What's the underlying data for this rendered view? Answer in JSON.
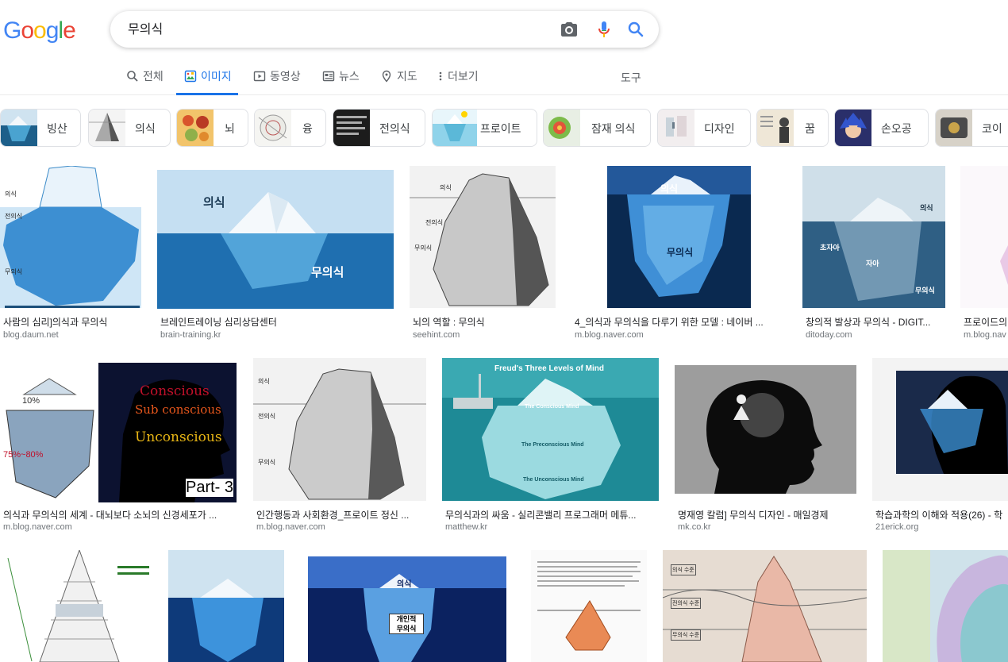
{
  "header": {
    "logo": [
      "G",
      "o",
      "o",
      "g",
      "l",
      "e"
    ],
    "logo_colors": [
      "#4285f4",
      "#ea4335",
      "#fbbc05",
      "#4285f4",
      "#34a853",
      "#ea4335"
    ],
    "query": "무의식"
  },
  "tabs": {
    "all": "전체",
    "images": "이미지",
    "videos": "동영상",
    "news": "뉴스",
    "maps": "지도",
    "more": "더보기",
    "tools": "도구"
  },
  "chips": [
    "빙산",
    "의식",
    "뇌",
    "융",
    "전의식",
    "프로이트",
    "잠재 의식",
    "디자인",
    "꿈",
    "손오공",
    "코이"
  ],
  "results": [
    {
      "title": "사람의 심리]의식과 무의식",
      "source": "blog.daum.net",
      "labels": [
        "의식",
        "전의식",
        "무의식"
      ]
    },
    {
      "title": "브레인트레이닝 심리상담센터",
      "source": "brain-training.kr",
      "labels": [
        "의식",
        "무의식"
      ]
    },
    {
      "title": "뇌의 역할 : 무의식",
      "source": "seehint.com",
      "labels": [
        "의식",
        "전의식",
        "무의식"
      ]
    },
    {
      "title": "4_의식과 무의식을 다루기 위한 모델 : 네이버 ...",
      "source": "m.blog.naver.com",
      "labels": [
        "의식",
        "무의식"
      ]
    },
    {
      "title": "창의적 발상과 무의식 - DIGIT...",
      "source": "ditoday.com",
      "labels": [
        "의식",
        "초자아",
        "자아",
        "무의식"
      ]
    },
    {
      "title": "프로이드의",
      "source": "m.blog.nav",
      "labels": []
    },
    {
      "title": "의식과 무의식의 세계 - 대뇌보다 소뇌의 신경세포가 ...",
      "source": "m.blog.naver.com",
      "labels": [
        "Conscious",
        "Sub conscious",
        "Unconscious",
        "Part- 3",
        "10%",
        "75%~80%"
      ]
    },
    {
      "title": "인간행동과 사회환경_프로이트 정신 ...",
      "source": "m.blog.naver.com",
      "labels": [
        "의식",
        "전의식",
        "무의식"
      ]
    },
    {
      "title": "무의식과의 싸움 - 실리콘밸리 프로그래머 메튜...",
      "source": "matthew.kr",
      "labels": [
        "Freud's Three Levels of Mind",
        "The Conscious Mind",
        "The Preconscious Mind",
        "The Unconscious Mind"
      ]
    },
    {
      "title": "명재영 칼럼] 무의식 디자인 - 매일경제",
      "source": "mk.co.kr",
      "labels": []
    },
    {
      "title": "학습과학의 이해와 적용(26) - 학",
      "source": "21erick.org",
      "labels": []
    },
    {
      "title": "",
      "source": "",
      "labels": []
    },
    {
      "title": "",
      "source": "",
      "labels": []
    },
    {
      "title": "",
      "source": "",
      "labels": [
        "의식",
        "개인적",
        "무의식"
      ]
    },
    {
      "title": "",
      "source": "",
      "labels": []
    },
    {
      "title": "",
      "source": "",
      "labels": [
        "의식 수준",
        "전의식 수준",
        "무의식 수준"
      ]
    },
    {
      "title": "",
      "source": "",
      "labels": []
    }
  ],
  "colors": {
    "accent": "#1a73e8",
    "text_secondary": "#5f6368",
    "source_gray": "#70757a"
  }
}
